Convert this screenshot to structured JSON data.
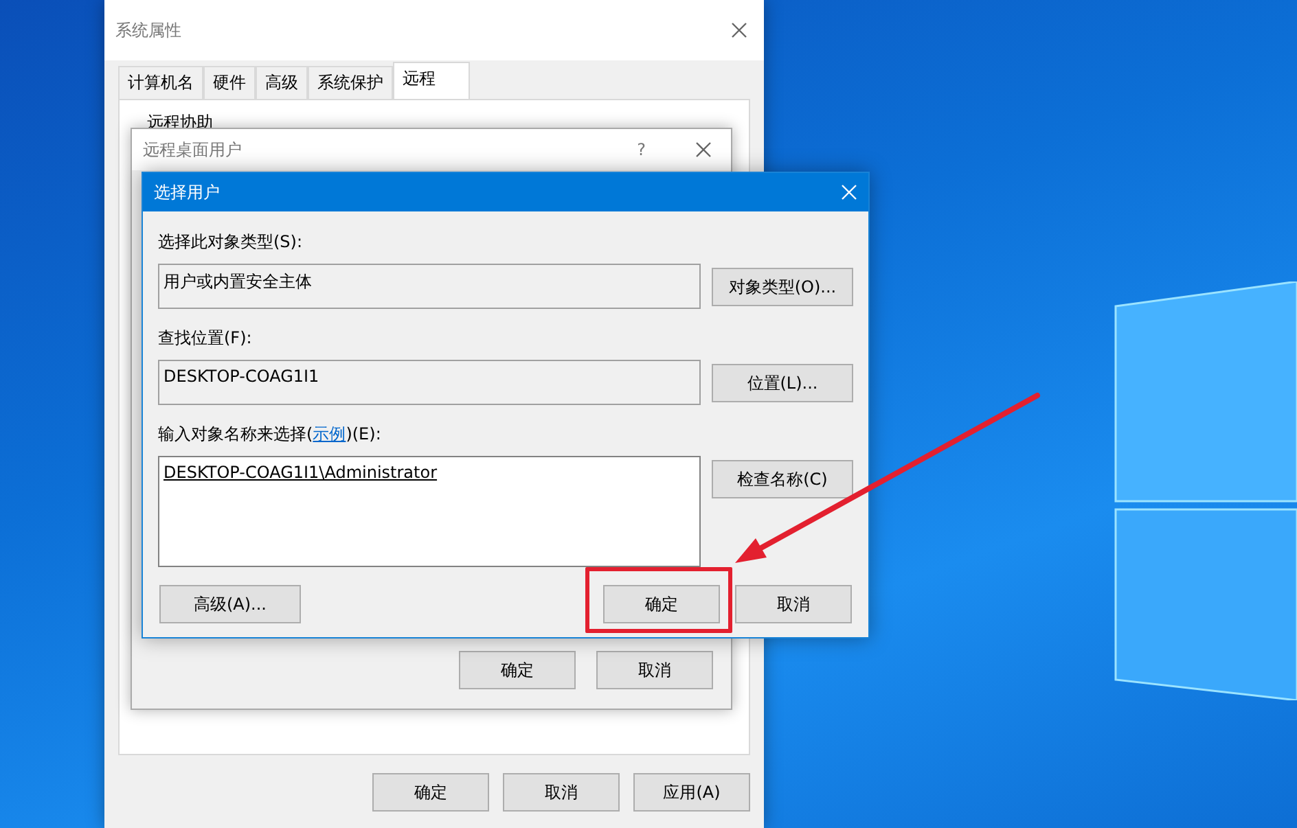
{
  "system_properties": {
    "title": "系统属性",
    "tabs": [
      {
        "label": "计算机名",
        "selected": false
      },
      {
        "label": "硬件",
        "selected": false
      },
      {
        "label": "高级",
        "selected": false
      },
      {
        "label": "系统保护",
        "selected": false
      },
      {
        "label": "远程",
        "selected": true
      }
    ],
    "section_heading": "远程协助",
    "buttons": [
      "确定",
      "取消",
      "应用(A)"
    ]
  },
  "remote_desktop_users": {
    "title": "远程桌面用户",
    "help": "?",
    "buttons": [
      "确定",
      "取消"
    ]
  },
  "select_users": {
    "title": "选择用户",
    "object_type": {
      "label": "选择此对象类型(S):",
      "value": "用户或内置安全主体",
      "button": "对象类型(O)..."
    },
    "location": {
      "label": "查找位置(F):",
      "value": "DESKTOP-COAG1I1",
      "button": "位置(L)..."
    },
    "names": {
      "label_before": "输入对象名称来选择(",
      "link": "示例",
      "label_after": ")(E):",
      "entry": "DESKTOP-COAG1I1\\Administrator",
      "button": "检查名称(C)"
    },
    "advanced_button": "高级(A)...",
    "buttons": [
      {
        "label": "确定",
        "highlighted": true
      },
      {
        "label": "取消",
        "highlighted": false
      }
    ]
  }
}
